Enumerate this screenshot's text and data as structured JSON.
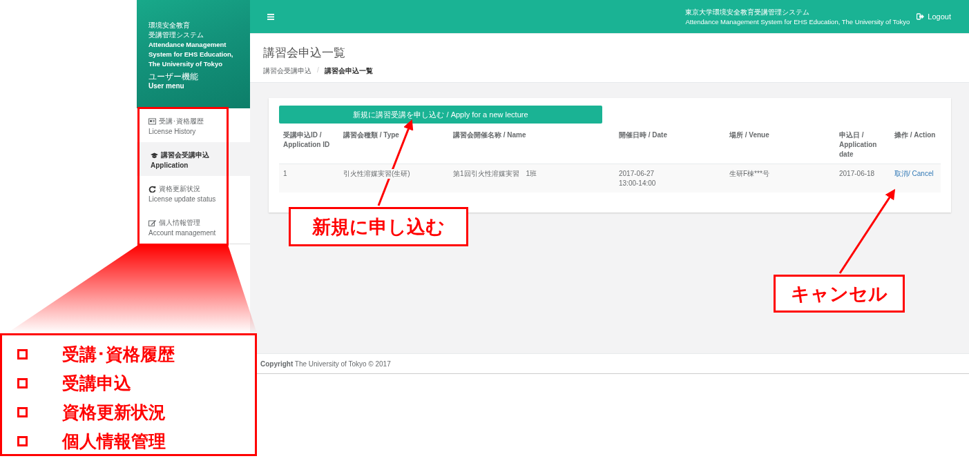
{
  "sidebar": {
    "title_ja_lines": [
      "環境安全教育",
      "受講管理システム"
    ],
    "title_en": "Attendance Management System for EHS Education, The University of Tokyo",
    "menu_label_ja": "ユーザー機能",
    "menu_label_en": "User menu",
    "items": [
      {
        "label_ja": "受講･資格履歴",
        "label_en": "License History",
        "selected": false
      },
      {
        "label_ja": "講習会受講申込",
        "label_en": "Application",
        "selected": true
      },
      {
        "label_ja": "資格更新状況",
        "label_en": "License update status",
        "selected": false
      },
      {
        "label_ja": "個人情報管理",
        "label_en": "Account management",
        "selected": false
      }
    ]
  },
  "topbar": {
    "system_ja": "東京大学環境安全教育受講管理システム",
    "system_en": "Attendance Management System for EHS Education, The University of Tokyo",
    "logout": "Logout"
  },
  "page": {
    "title": "講習会申込一覧",
    "breadcrumb": [
      {
        "label": "講習会受講申込",
        "current": false
      },
      {
        "label": "講習会申込一覧",
        "current": true
      }
    ],
    "breadcrumb_separator": "/"
  },
  "new_button": "新規に講習受講を申し込む / Apply for a new lecture",
  "table": {
    "columns": [
      "受講申込ID / Application ID",
      "講習会種類 / Type",
      "講習会開催名称 / Name",
      "開催日時 / Date",
      "場所 / Venue",
      "申込日 / Application date",
      "操作 / Action"
    ],
    "rows": [
      {
        "cells": [
          "1",
          "引火性溶媒実習(生研)",
          "第1回引火性溶媒実習　1班",
          "2017-06-27\n13:00-14:00",
          "生研F棟***号",
          "2017-06-18"
        ],
        "action": "取消/ Cancel"
      }
    ]
  },
  "footer": "**Copyright** The University of Tokyo © 2017",
  "annotations": {
    "callouts": [
      "新規に申し込む",
      "キャンセル"
    ],
    "legend": [
      "受講･資格履歴",
      "受講申込",
      "資格更新状況",
      "個人情報管理"
    ]
  }
}
